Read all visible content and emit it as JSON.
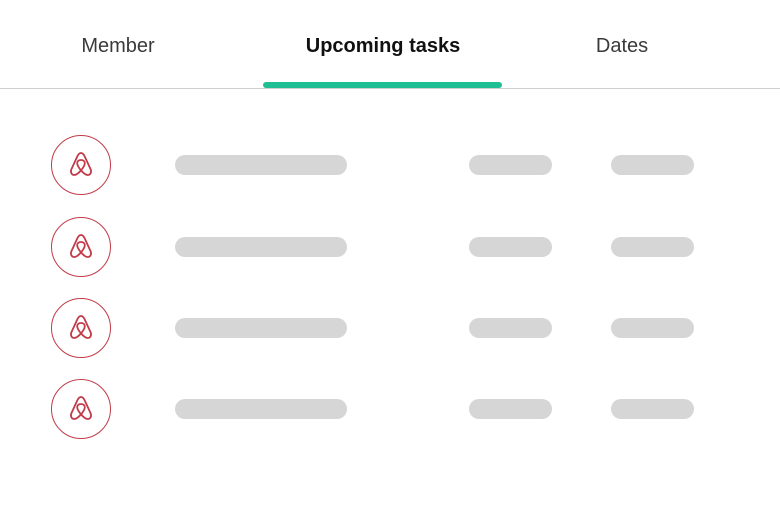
{
  "tabs": [
    {
      "label": "Member",
      "active": false
    },
    {
      "label": "Upcoming tasks",
      "active": true
    },
    {
      "label": "Dates",
      "active": false
    }
  ],
  "colors": {
    "accent": "#1fbf93",
    "brand": "#c23b48",
    "placeholder": "#d6d6d6",
    "divider": "#cfcfcf"
  },
  "rows": [
    {
      "icon": "airbnb-logo-icon"
    },
    {
      "icon": "airbnb-logo-icon"
    },
    {
      "icon": "airbnb-logo-icon"
    },
    {
      "icon": "airbnb-logo-icon"
    }
  ]
}
